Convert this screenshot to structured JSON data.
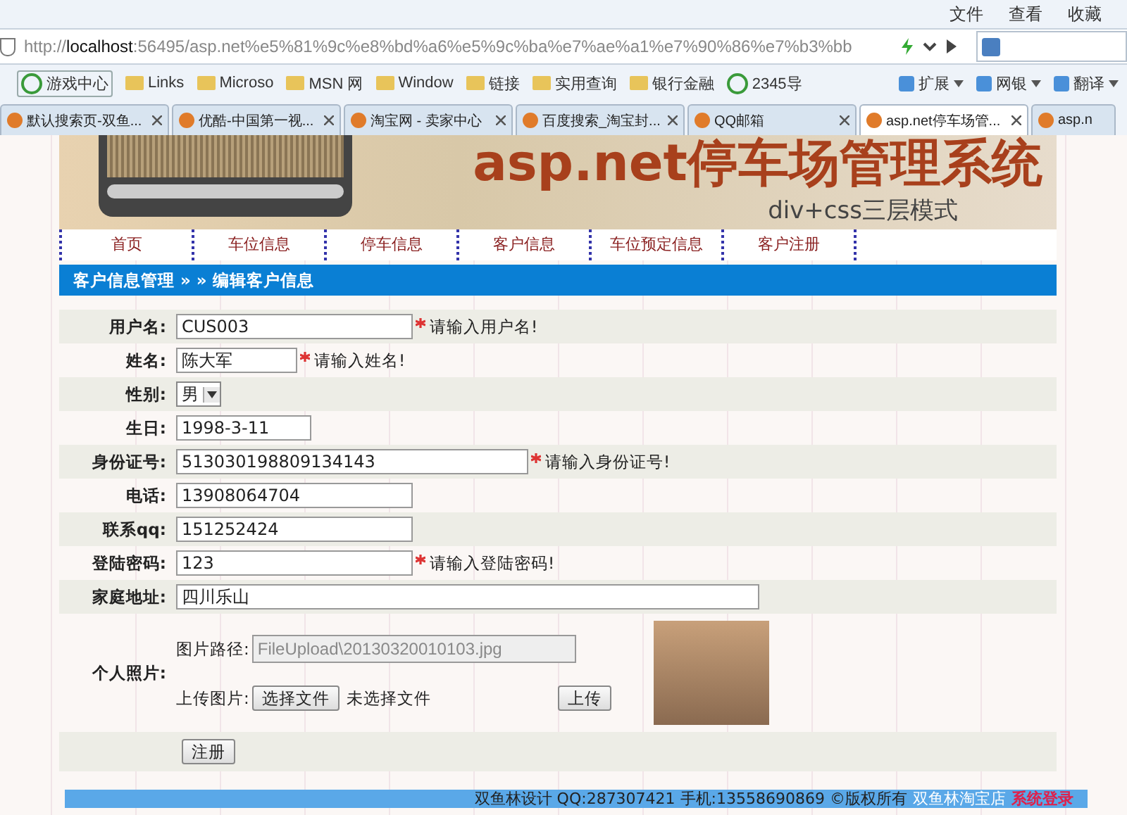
{
  "browser": {
    "menu": [
      "文件",
      "查看",
      "收藏"
    ],
    "address": "http://**localhost**:56495/asp.net%e5%81%9c%e8%bd%a6%e5%9c%ba%e7%ae%a1%e7%90%86%e7%b3%bb",
    "bookmarks": [
      {
        "label": "游戏中心",
        "kind": "app"
      },
      {
        "label": "Links",
        "kind": "folder"
      },
      {
        "label": "Microso",
        "kind": "folder"
      },
      {
        "label": "MSN 网",
        "kind": "folder"
      },
      {
        "label": "Window",
        "kind": "folder"
      },
      {
        "label": "链接",
        "kind": "folder"
      },
      {
        "label": "实用查询",
        "kind": "folder"
      },
      {
        "label": "银行金融",
        "kind": "folder"
      },
      {
        "label": "2345导",
        "kind": "app"
      }
    ],
    "tools": [
      "扩展",
      "网银",
      "翻译"
    ],
    "tabs": [
      {
        "label": "默认搜索页-双鱼...",
        "selected": false
      },
      {
        "label": "优酷-中国第一视...",
        "selected": false
      },
      {
        "label": "淘宝网 - 卖家中心",
        "selected": false
      },
      {
        "label": "百度搜索_淘宝封...",
        "selected": false
      },
      {
        "label": "QQ邮箱",
        "selected": false
      },
      {
        "label": "asp.net停车场管...",
        "selected": true
      },
      {
        "label": "asp.n",
        "selected": false
      }
    ]
  },
  "header": {
    "title": "asp.net停车场管理系统",
    "subtitle": "div+css三层模式"
  },
  "nav": [
    "首页",
    "车位信息",
    "停车信息",
    "客户信息",
    "车位预定信息",
    "客户注册"
  ],
  "breadcrumb": "客户信息管理 » » 编辑客户信息",
  "form": [
    {
      "kind": "text",
      "label": "用户名:",
      "value": "CUS003",
      "required": true,
      "hint": "请输入用户名!"
    },
    {
      "kind": "text",
      "label": "姓名:",
      "value": "陈大军",
      "required": true,
      "hint": "请输入姓名!"
    },
    {
      "kind": "select",
      "label": "性别:",
      "value": "男"
    },
    {
      "kind": "text",
      "label": "生日:",
      "value": "1998-3-11",
      "required": false
    },
    {
      "kind": "text",
      "label": "身份证号:",
      "value": "513030198809134143",
      "required": true,
      "hint": "请输入身份证号!"
    },
    {
      "kind": "text",
      "label": "电话:",
      "value": "13908064704",
      "required": false
    },
    {
      "kind": "text",
      "label": "联系qq:",
      "value": "151252424",
      "required": false
    },
    {
      "kind": "text",
      "label": "登陆密码:",
      "value": "123",
      "required": true,
      "hint": "请输入登陆密码!"
    },
    {
      "kind": "text",
      "label": "家庭地址:",
      "value": "四川乐山",
      "required": false
    },
    {
      "kind": "photo",
      "label": "个人照片:",
      "path_label": "图片路径:",
      "path": "FileUpload\\20130320010103.jpg",
      "upload_label": "上传图片:",
      "choose": "选择文件",
      "no_file": "未选择文件",
      "upload": "上传"
    },
    {
      "kind": "submit",
      "button": "注册"
    }
  ],
  "footer": {
    "text": "双鱼林设计 QQ:287307421 手机:13558690869 ©版权所有",
    "shop": "双鱼林淘宝店",
    "login": "系统登录"
  }
}
